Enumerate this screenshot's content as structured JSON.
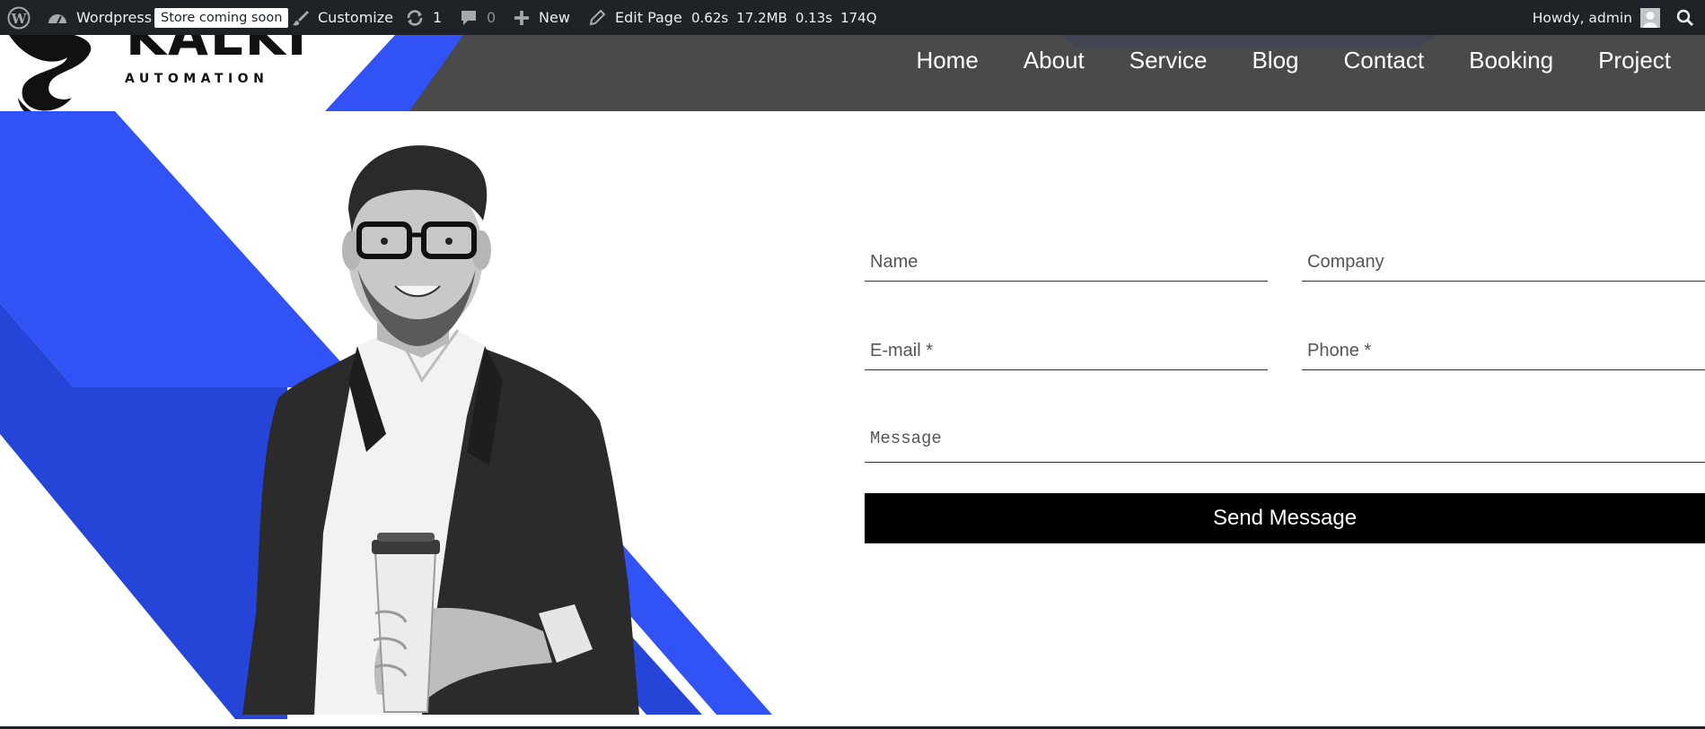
{
  "admin_bar": {
    "site_name": "Wordpress",
    "store_badge": "Store coming soon",
    "customize": "Customize",
    "updates_count": "1",
    "comments_count": "0",
    "new_label": "New",
    "edit_page": "Edit Page",
    "perf_time": "0.62s",
    "perf_memory": "17.2MB",
    "perf_query_time": "0.13s",
    "perf_queries": "174Q",
    "howdy": "Howdy, admin"
  },
  "header": {
    "logo_top": "KALKI",
    "logo_subtitle": "AUTOMATION",
    "nav": [
      "Home",
      "About",
      "Service",
      "Blog",
      "Contact",
      "Booking",
      "Project"
    ]
  },
  "form": {
    "name_placeholder": "Name",
    "company_placeholder": "Company",
    "email_placeholder": "E-mail *",
    "phone_placeholder": "Phone *",
    "message_placeholder": "Message",
    "send_label": "Send Message"
  },
  "colors": {
    "admin_bar_bg": "#1d2327",
    "header_bg": "#4a4a4a",
    "accent_blue": "#3152f5",
    "accent_blue_dark": "#2545d8",
    "button_bg": "#000000"
  }
}
